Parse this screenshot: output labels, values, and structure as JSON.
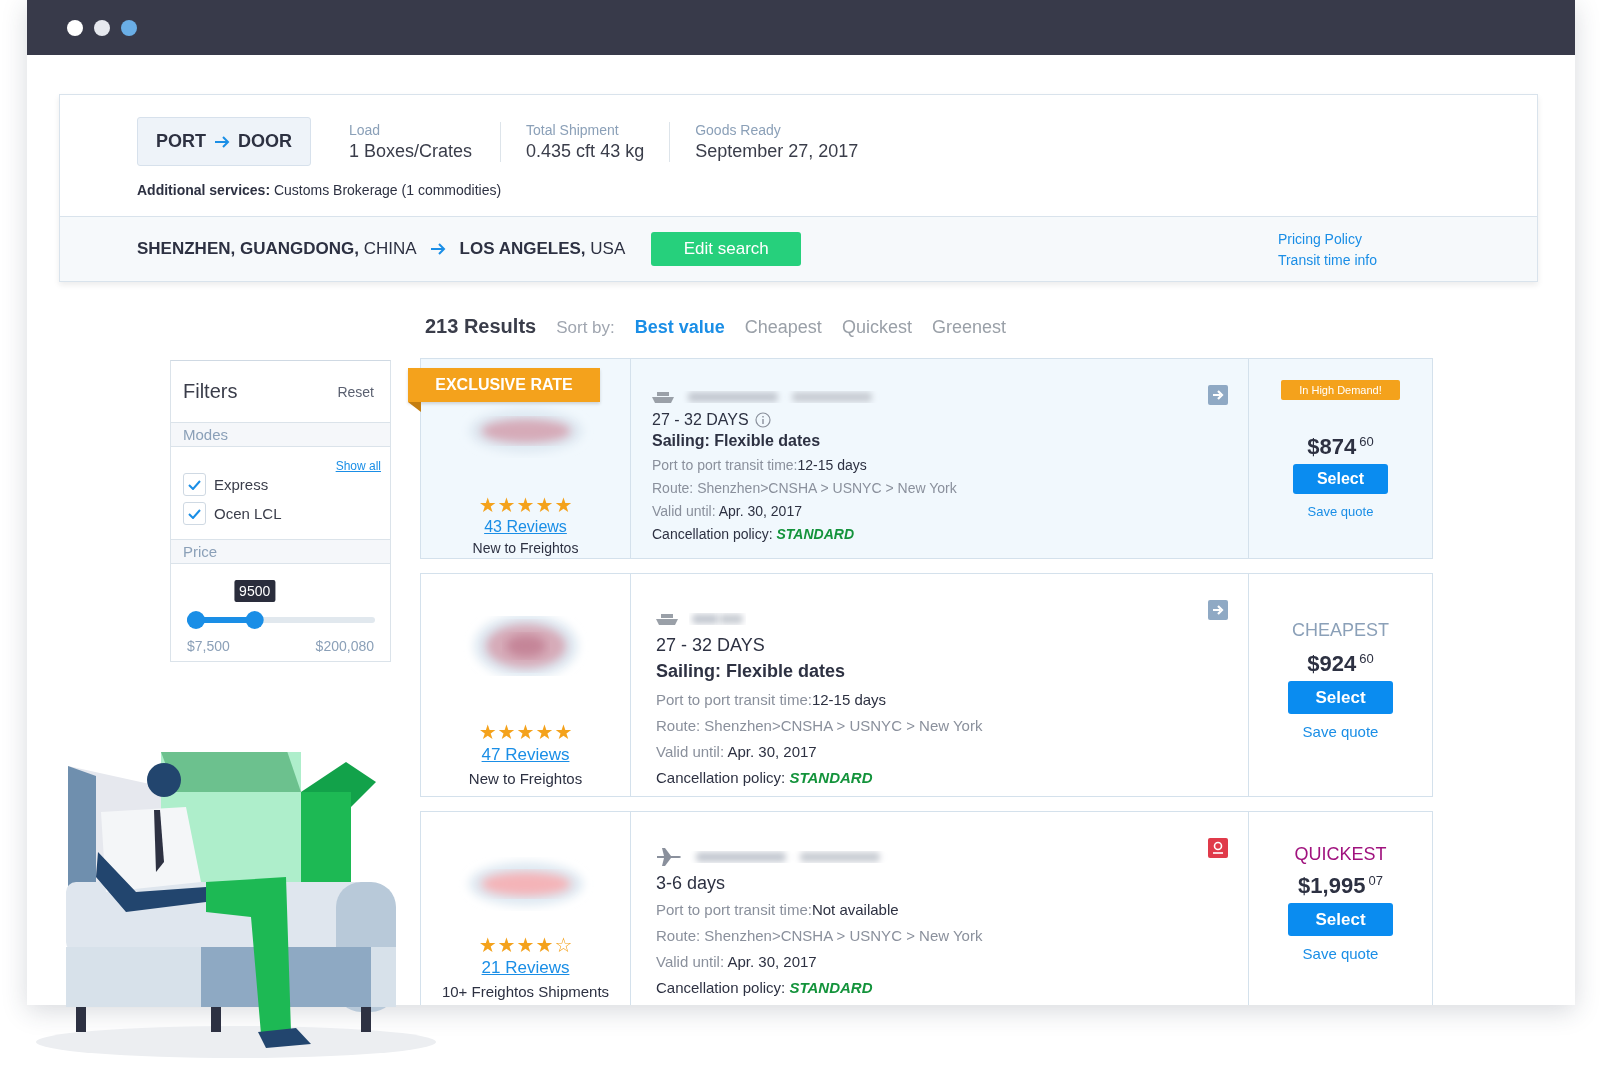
{
  "summary": {
    "mode": {
      "from": "PORT",
      "to": "DOOR"
    },
    "fields": [
      {
        "label": "Load",
        "value": "1 Boxes/Crates"
      },
      {
        "label": "Total Shipment",
        "value": "0.435 cft 43 kg"
      },
      {
        "label": "Goods Ready",
        "value": "September 27, 2017"
      }
    ],
    "additional": {
      "label": "Additional services:",
      "value": "Customs Brokerage (1 commodities)"
    },
    "route": {
      "origin": "SHENZHEN, GUANGDONG,",
      "origin_country": "CHINA",
      "destination": "LOS ANGELES,",
      "destination_country": "USA"
    },
    "edit_button": "Edit search",
    "links": [
      "Pricing Policy",
      "Transit time info"
    ]
  },
  "results": {
    "count": "213 Results",
    "sort_label": "Sort by:",
    "sort_options": [
      {
        "label": "Best value",
        "selected": true
      },
      {
        "label": "Cheapest",
        "selected": false
      },
      {
        "label": "Quickest",
        "selected": false
      },
      {
        "label": "Greenest",
        "selected": false
      }
    ]
  },
  "filters": {
    "title": "Filters",
    "reset": "Reset",
    "modes": {
      "title": "Modes",
      "show_all": "Show all",
      "items": [
        {
          "label": "Express",
          "checked": true
        },
        {
          "label": "Ocen LCL",
          "checked": true
        }
      ]
    },
    "price": {
      "title": "Price",
      "tooltip": "9500",
      "level": 0.36,
      "min": "$7,500",
      "max": "$200,080"
    }
  },
  "cards": [
    {
      "badge": "EXCLUSIVE RATE",
      "highlighted": true,
      "mode_icon": {
        "kind": "ship"
      },
      "stars": 5,
      "reviews": "43 Reviews",
      "note": "New to Freightos",
      "duration": "27 - 32 DAYS",
      "info": true,
      "sailing": "Sailing: Flexible dates",
      "transit_label": "Port to port transit time:",
      "transit_value": "12-15 days",
      "route": "Route: Shenzhen>CNSHA > USNYC > New York",
      "valid_label": "Valid until:",
      "valid_value": "Apr. 30, 2017",
      "cancel_label": "Cancellation policy:",
      "cancel_value": "STANDARD",
      "action_icon": {
        "kind": "arrow"
      },
      "tag": {
        "kind": "demand",
        "text": "In High Demand!"
      },
      "price": "$874",
      "cents": "60",
      "select": "Select",
      "save": "Save quote"
    },
    {
      "highlighted": false,
      "mode_icon": {
        "kind": "ship"
      },
      "stars": 5,
      "reviews": "47 Reviews",
      "note": "New to Freightos",
      "duration": "27 - 32 DAYS",
      "info": false,
      "sailing": "Sailing: Flexible dates",
      "transit_label": "Port to port transit time:",
      "transit_value": "12-15 days",
      "route": "Route: Shenzhen>CNSHA > USNYC > New York",
      "valid_label": "Valid until:",
      "valid_value": "Apr. 30, 2017",
      "cancel_label": "Cancellation policy:",
      "cancel_value": "STANDARD",
      "action_icon": {
        "kind": "arrow"
      },
      "tag": {
        "kind": "cheapest",
        "text": "CHEAPEST"
      },
      "price": "$924",
      "cents": "60",
      "select": "Select",
      "save": "Save quote"
    },
    {
      "highlighted": false,
      "mode_icon": {
        "kind": "plane"
      },
      "stars": 4,
      "reviews": "21 Reviews",
      "note": "10+ Freightos Shipments",
      "duration": "3-6 days",
      "info": false,
      "transit_label": "Port to port transit time:",
      "transit_value": "Not available",
      "route": "Route: Shenzhen>CNSHA > USNYC > New York",
      "valid_label": "Valid until:",
      "valid_value": "Apr. 30, 2017",
      "cancel_label": "Cancellation policy:",
      "cancel_value": "STANDARD",
      "action_icon": {
        "kind": "pin"
      },
      "tag": {
        "kind": "quickest",
        "text": "QUICKEST"
      },
      "price": "$1,995",
      "cents": "07",
      "select": "Select",
      "save": "Save quote"
    }
  ]
}
